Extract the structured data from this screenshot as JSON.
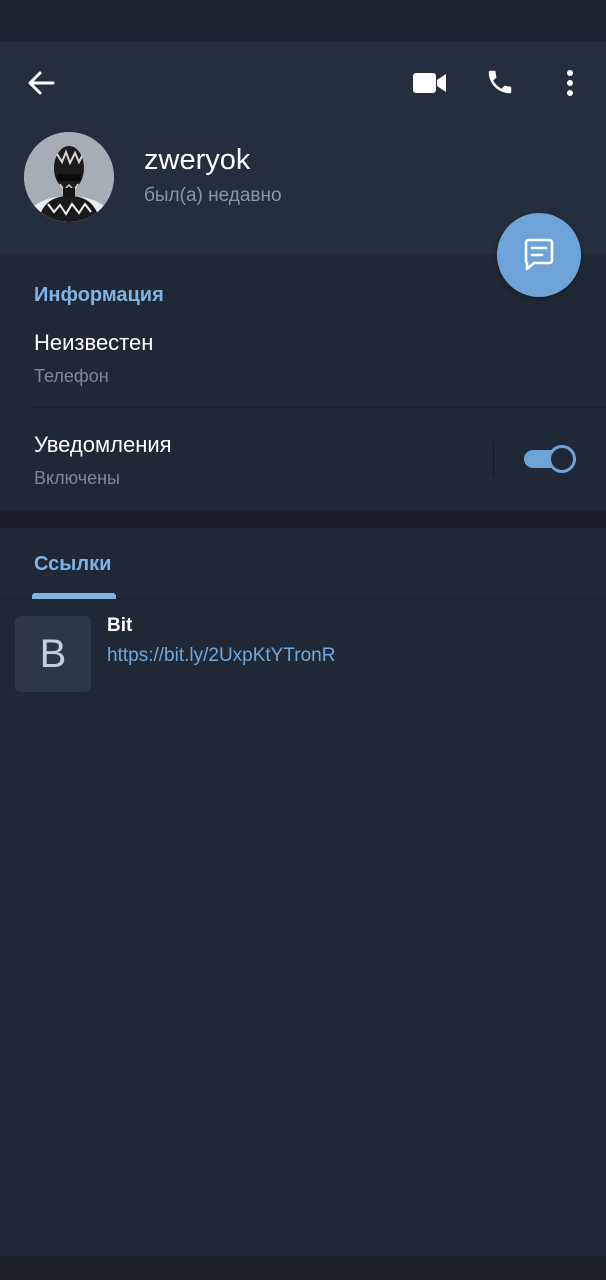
{
  "profile": {
    "name": "zweryok",
    "status": "был(а) недавно"
  },
  "info": {
    "section_title": "Информация",
    "phone_value": "Неизвестен",
    "phone_label": "Телефон",
    "notifications_label": "Уведомления",
    "notifications_value": "Включены",
    "notifications_enabled": true
  },
  "tabs": {
    "links_label": "Ссылки"
  },
  "links": [
    {
      "thumb_letter": "B",
      "title": "Bit",
      "url": "https://bit.ly/2UxpKtYTronR"
    }
  ],
  "icons": {
    "back": "arrow-left-icon",
    "video": "video-call-icon",
    "call": "phone-icon",
    "more": "more-vertical-icon",
    "message": "message-icon"
  },
  "colors": {
    "accent": "#6ea3d9",
    "link": "#6ea8e0",
    "header_bg": "#242e3c",
    "body_bg": "#212835"
  }
}
